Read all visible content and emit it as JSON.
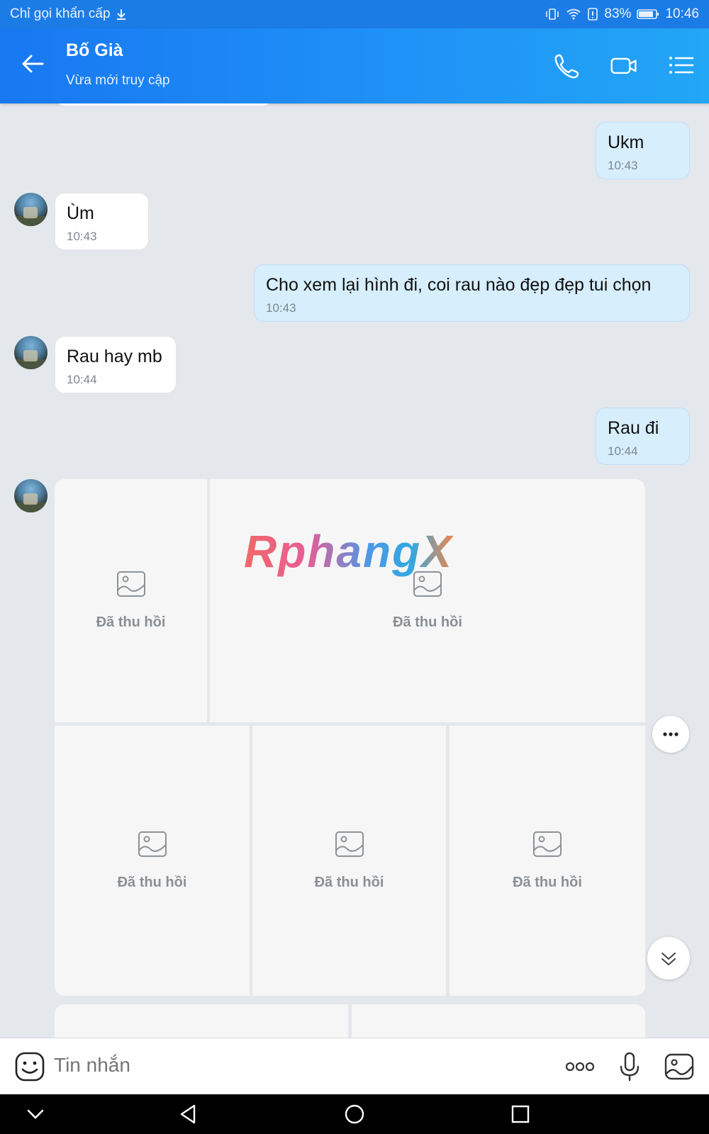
{
  "status_bar": {
    "carrier": "Chỉ gọi khẩn cấp",
    "battery": "83%",
    "time": "10:46"
  },
  "header": {
    "contact_name": "Bố Già",
    "presence": "Vừa mới truy cập"
  },
  "messages": [
    {
      "from": "me",
      "text": "Ukm",
      "time": "10:43"
    },
    {
      "from": "them",
      "text": "Ùm",
      "time": "10:43"
    },
    {
      "from": "me",
      "text": "Cho xem lại hình đi, coi rau nào đẹp đẹp tui chọn",
      "time": "10:43"
    },
    {
      "from": "them",
      "text": "Rau hay mb",
      "time": "10:44"
    },
    {
      "from": "me",
      "text": "Rau đi",
      "time": "10:44"
    }
  ],
  "recalled_photos": {
    "label": "Đã thu hồi",
    "tiles": [
      "Đã thu hồi",
      "Đã thu hồi",
      "Đã thu hồi",
      "Đã thu hồi",
      "Đã thu hồi"
    ]
  },
  "watermark": "RphangX",
  "composer": {
    "placeholder": "Tin nhắn"
  },
  "colors": {
    "header_start": "#1878f2",
    "header_end": "#22a6f6",
    "my_bubble": "#d7eefc",
    "their_bubble": "#ffffff",
    "chat_background": "#e4e8ed"
  }
}
